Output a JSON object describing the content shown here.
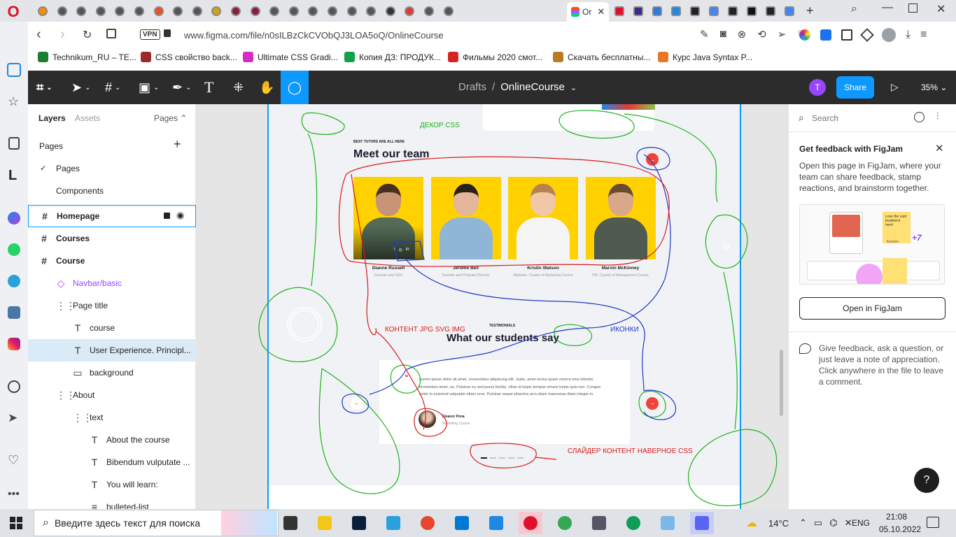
{
  "browser": {
    "active_tab_label": "Or",
    "address": "www.figma.com/file/n0sILBzCkCVObQJ3LOA5oQ/OnlineCourse",
    "vpn": "VPN",
    "bookmarks": [
      {
        "label": "Technikum_RU – TE...",
        "color": "#1e7d32"
      },
      {
        "label": "CSS свойство back...",
        "color": "#9c2b2b"
      },
      {
        "label": "Ultimate CSS Gradi...",
        "color": "#d92bc7"
      },
      {
        "label": "Копия ДЗ: ПРОДУК...",
        "color": "#11a04a"
      },
      {
        "label": "Фильмы 2020 смот...",
        "color": "#d62222"
      },
      {
        "label": "Скачать бесплатны...",
        "color": "#b87a22"
      },
      {
        "label": "Курс Java Syntax P...",
        "color": "#e87722"
      }
    ]
  },
  "figma": {
    "breadcrumb_drafts": "Drafts",
    "breadcrumb_sep": "/",
    "file_name": "OnlineCourse",
    "avatar_letter": "T",
    "share_label": "Share",
    "zoom": "35%",
    "left_tabs": {
      "layers": "Layers",
      "assets": "Assets",
      "pages": "Pages"
    },
    "pages_header": "Pages",
    "pages": [
      "Pages",
      "Components"
    ],
    "layers": [
      {
        "label": "Homepage",
        "icon": "#"
      },
      {
        "label": "Courses",
        "icon": "#"
      },
      {
        "label": "Course",
        "icon": "#"
      },
      {
        "label": "Navbar/basic",
        "icon": "◇"
      },
      {
        "label": "Page title",
        "icon": "⋮⋮"
      },
      {
        "label": "course",
        "icon": "T"
      },
      {
        "label": "User Experience. Principl...",
        "icon": "T"
      },
      {
        "label": "background",
        "icon": "▭"
      },
      {
        "label": "About",
        "icon": "⋮⋮"
      },
      {
        "label": "text",
        "icon": "⋮⋮"
      },
      {
        "label": "About the course",
        "icon": "T"
      },
      {
        "label": "Bibendum vulputate ...",
        "icon": "T"
      },
      {
        "label": "You will learn:",
        "icon": "T"
      },
      {
        "label": "bulleted-list",
        "icon": "≡"
      }
    ],
    "right": {
      "search_placeholder": "Search",
      "fj_title": "Get feedback with FigJam",
      "fj_desc": "Open this page in FigJam, where your team can share feedback, stamp reactions, and brainstorm together.",
      "fj_note": "Love the card treatment here!",
      "fj_user": "Keeyen",
      "fj_count": "+7",
      "fj_btn": "Open in FigJam",
      "feedback_text": "Give feedback, ask a question, or just leave a note of appreciation. Click anywhere in the file to leave a comment.",
      "help": "?"
    }
  },
  "canvas": {
    "team_kicker": "BEST TUTORS ARE ALL HERE",
    "team_title": "Meet our team",
    "members": [
      {
        "name": "Dianne Russell",
        "role": "Founder and CEO"
      },
      {
        "name": "Jerome Bell",
        "role": "Founder and Program Director"
      },
      {
        "name": "Kristin Watson",
        "role": "Marketer, Curator of Marketing Course"
      },
      {
        "name": "Marvin McKinney",
        "role": "PM, Curator of Management Course"
      }
    ],
    "social": [
      "f",
      "◎",
      "in"
    ],
    "test_kicker": "TESTIMONIALS",
    "test_title": "What our students say",
    "quote": "Lorem ipsum dolor sit amet, consectetur adipiscing elit. Justo, amet lectus quam viverra mus lobortis fermentum amet, eu. Pulvinar eu sed purus facilisi. Vitae id turpis tempus ornare turpis quis non. Congue tortor in euismod vulputate etiam eros. Pulvinar neque pharetra arcu diam maecenas diam integer in.",
    "student_name": "Eleanor Pena",
    "student_course": "Marketing Course",
    "quote_mark": "❝",
    "arrow_left": "←",
    "arrow_right": "→",
    "annotations": {
      "decor": "ДЕКОР CSS",
      "content": "КОНТЕНТ JPG SVG IMG",
      "icons": "ИКОНКИ",
      "slider": "СЛАЙДЕР КОНТЕНТ НАВЕРНОЕ CSS"
    }
  },
  "taskbar": {
    "search_placeholder": "Введите здесь текст для поиска",
    "weather": "14°C",
    "lang": "ENG",
    "time": "21:08",
    "date": "05.10.2022"
  }
}
